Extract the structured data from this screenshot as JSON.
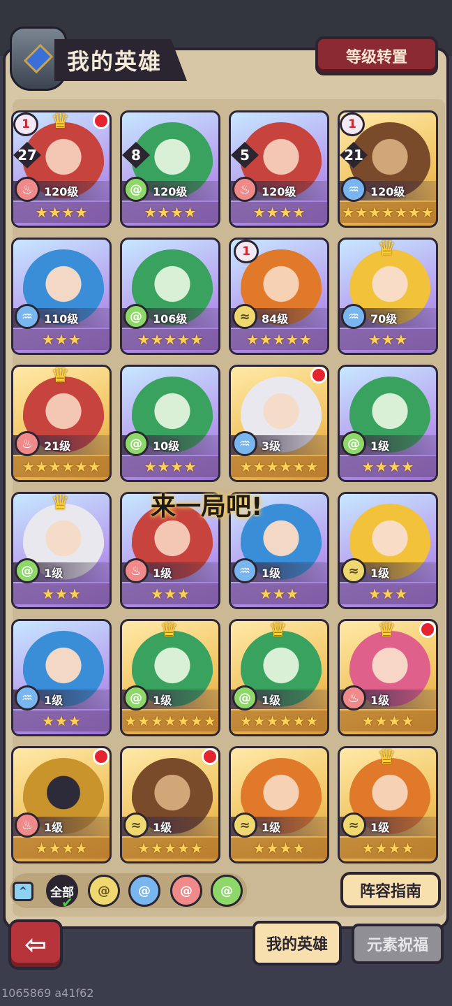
{
  "header": {
    "title": "我的英雄",
    "level_transfer_label": "等级转置"
  },
  "overlay_text": "来一局吧!",
  "heroes": [
    {
      "level": "120级",
      "element": "fire",
      "stars": 4,
      "rank": "1",
      "count": "27",
      "crown": true,
      "red_dot": true,
      "frame": "purple",
      "portrait": "red"
    },
    {
      "level": "120级",
      "element": "wind",
      "stars": 4,
      "rank": "",
      "count": "8",
      "crown": false,
      "red_dot": false,
      "frame": "purple",
      "portrait": "green"
    },
    {
      "level": "120级",
      "element": "fire",
      "stars": 4,
      "rank": "",
      "count": "5",
      "crown": false,
      "red_dot": false,
      "frame": "purple",
      "portrait": "red"
    },
    {
      "level": "120级",
      "element": "water",
      "stars": 7,
      "rank": "1",
      "count": "21",
      "crown": false,
      "red_dot": false,
      "frame": "gold",
      "portrait": "brown"
    },
    {
      "level": "110级",
      "element": "water",
      "stars": 3,
      "rank": "",
      "count": "",
      "crown": false,
      "red_dot": false,
      "frame": "purple",
      "portrait": "blue"
    },
    {
      "level": "106级",
      "element": "wind",
      "stars": 5,
      "rank": "",
      "count": "",
      "crown": false,
      "red_dot": false,
      "frame": "purple",
      "portrait": "green"
    },
    {
      "level": "84级",
      "element": "earth",
      "stars": 5,
      "rank": "1",
      "count": "",
      "crown": false,
      "red_dot": false,
      "frame": "purple",
      "portrait": "orange"
    },
    {
      "level": "70级",
      "element": "water",
      "stars": 3,
      "rank": "",
      "count": "",
      "crown": true,
      "red_dot": false,
      "frame": "purple",
      "portrait": "yellow"
    },
    {
      "level": "21级",
      "element": "fire",
      "stars": 6,
      "rank": "",
      "count": "",
      "crown": true,
      "red_dot": false,
      "frame": "gold",
      "portrait": "red"
    },
    {
      "level": "10级",
      "element": "wind",
      "stars": 4,
      "rank": "",
      "count": "",
      "crown": false,
      "red_dot": false,
      "frame": "purple",
      "portrait": "green"
    },
    {
      "level": "3级",
      "element": "water",
      "stars": 6,
      "rank": "",
      "count": "",
      "crown": false,
      "red_dot": true,
      "frame": "gold",
      "portrait": "white"
    },
    {
      "level": "1级",
      "element": "wind",
      "stars": 4,
      "rank": "",
      "count": "",
      "crown": false,
      "red_dot": false,
      "frame": "purple",
      "portrait": "green"
    },
    {
      "level": "1级",
      "element": "wind",
      "stars": 3,
      "rank": "",
      "count": "",
      "crown": true,
      "red_dot": false,
      "frame": "purple",
      "portrait": "white"
    },
    {
      "level": "1级",
      "element": "fire",
      "stars": 3,
      "rank": "",
      "count": "",
      "crown": false,
      "red_dot": false,
      "frame": "purple",
      "portrait": "red"
    },
    {
      "level": "1级",
      "element": "water",
      "stars": 3,
      "rank": "",
      "count": "",
      "crown": false,
      "red_dot": false,
      "frame": "purple",
      "portrait": "blue"
    },
    {
      "level": "1级",
      "element": "earth",
      "stars": 3,
      "rank": "",
      "count": "",
      "crown": false,
      "red_dot": false,
      "frame": "purple",
      "portrait": "yellow"
    },
    {
      "level": "1级",
      "element": "water",
      "stars": 3,
      "rank": "",
      "count": "",
      "crown": false,
      "red_dot": false,
      "frame": "purple",
      "portrait": "blue"
    },
    {
      "level": "1级",
      "element": "wind",
      "stars": 7,
      "rank": "",
      "count": "",
      "crown": true,
      "red_dot": false,
      "frame": "gold",
      "portrait": "green"
    },
    {
      "level": "1级",
      "element": "wind",
      "stars": 6,
      "rank": "",
      "count": "",
      "crown": true,
      "red_dot": false,
      "frame": "gold",
      "portrait": "green"
    },
    {
      "level": "1级",
      "element": "fire",
      "stars": 4,
      "rank": "",
      "count": "",
      "crown": true,
      "red_dot": true,
      "frame": "gold",
      "portrait": "pink"
    },
    {
      "level": "1级",
      "element": "fire",
      "stars": 4,
      "rank": "",
      "count": "",
      "crown": false,
      "red_dot": true,
      "frame": "gold",
      "portrait": "gold"
    },
    {
      "level": "1级",
      "element": "earth",
      "stars": 5,
      "rank": "",
      "count": "",
      "crown": false,
      "red_dot": true,
      "frame": "gold",
      "portrait": "brown"
    },
    {
      "level": "1级",
      "element": "earth",
      "stars": 4,
      "rank": "",
      "count": "",
      "crown": false,
      "red_dot": false,
      "frame": "gold",
      "portrait": "orange"
    },
    {
      "level": "1级",
      "element": "earth",
      "stars": 4,
      "rank": "",
      "count": "",
      "crown": true,
      "red_dot": false,
      "frame": "gold",
      "portrait": "orange"
    }
  ],
  "filters": {
    "all_label": "全部",
    "items": [
      "earth",
      "water",
      "fire",
      "wind"
    ]
  },
  "lineup_guide_label": "阵容指南",
  "tabs": {
    "my_heroes": "我的英雄",
    "element_blessing": "元素祝福"
  },
  "footer_id": "1065869 a41f62",
  "colors": {
    "background": "#3b3d4c",
    "panel": "#d8c7a6",
    "accent_red": "#8c2a33",
    "button_cream": "#f7dfae"
  }
}
